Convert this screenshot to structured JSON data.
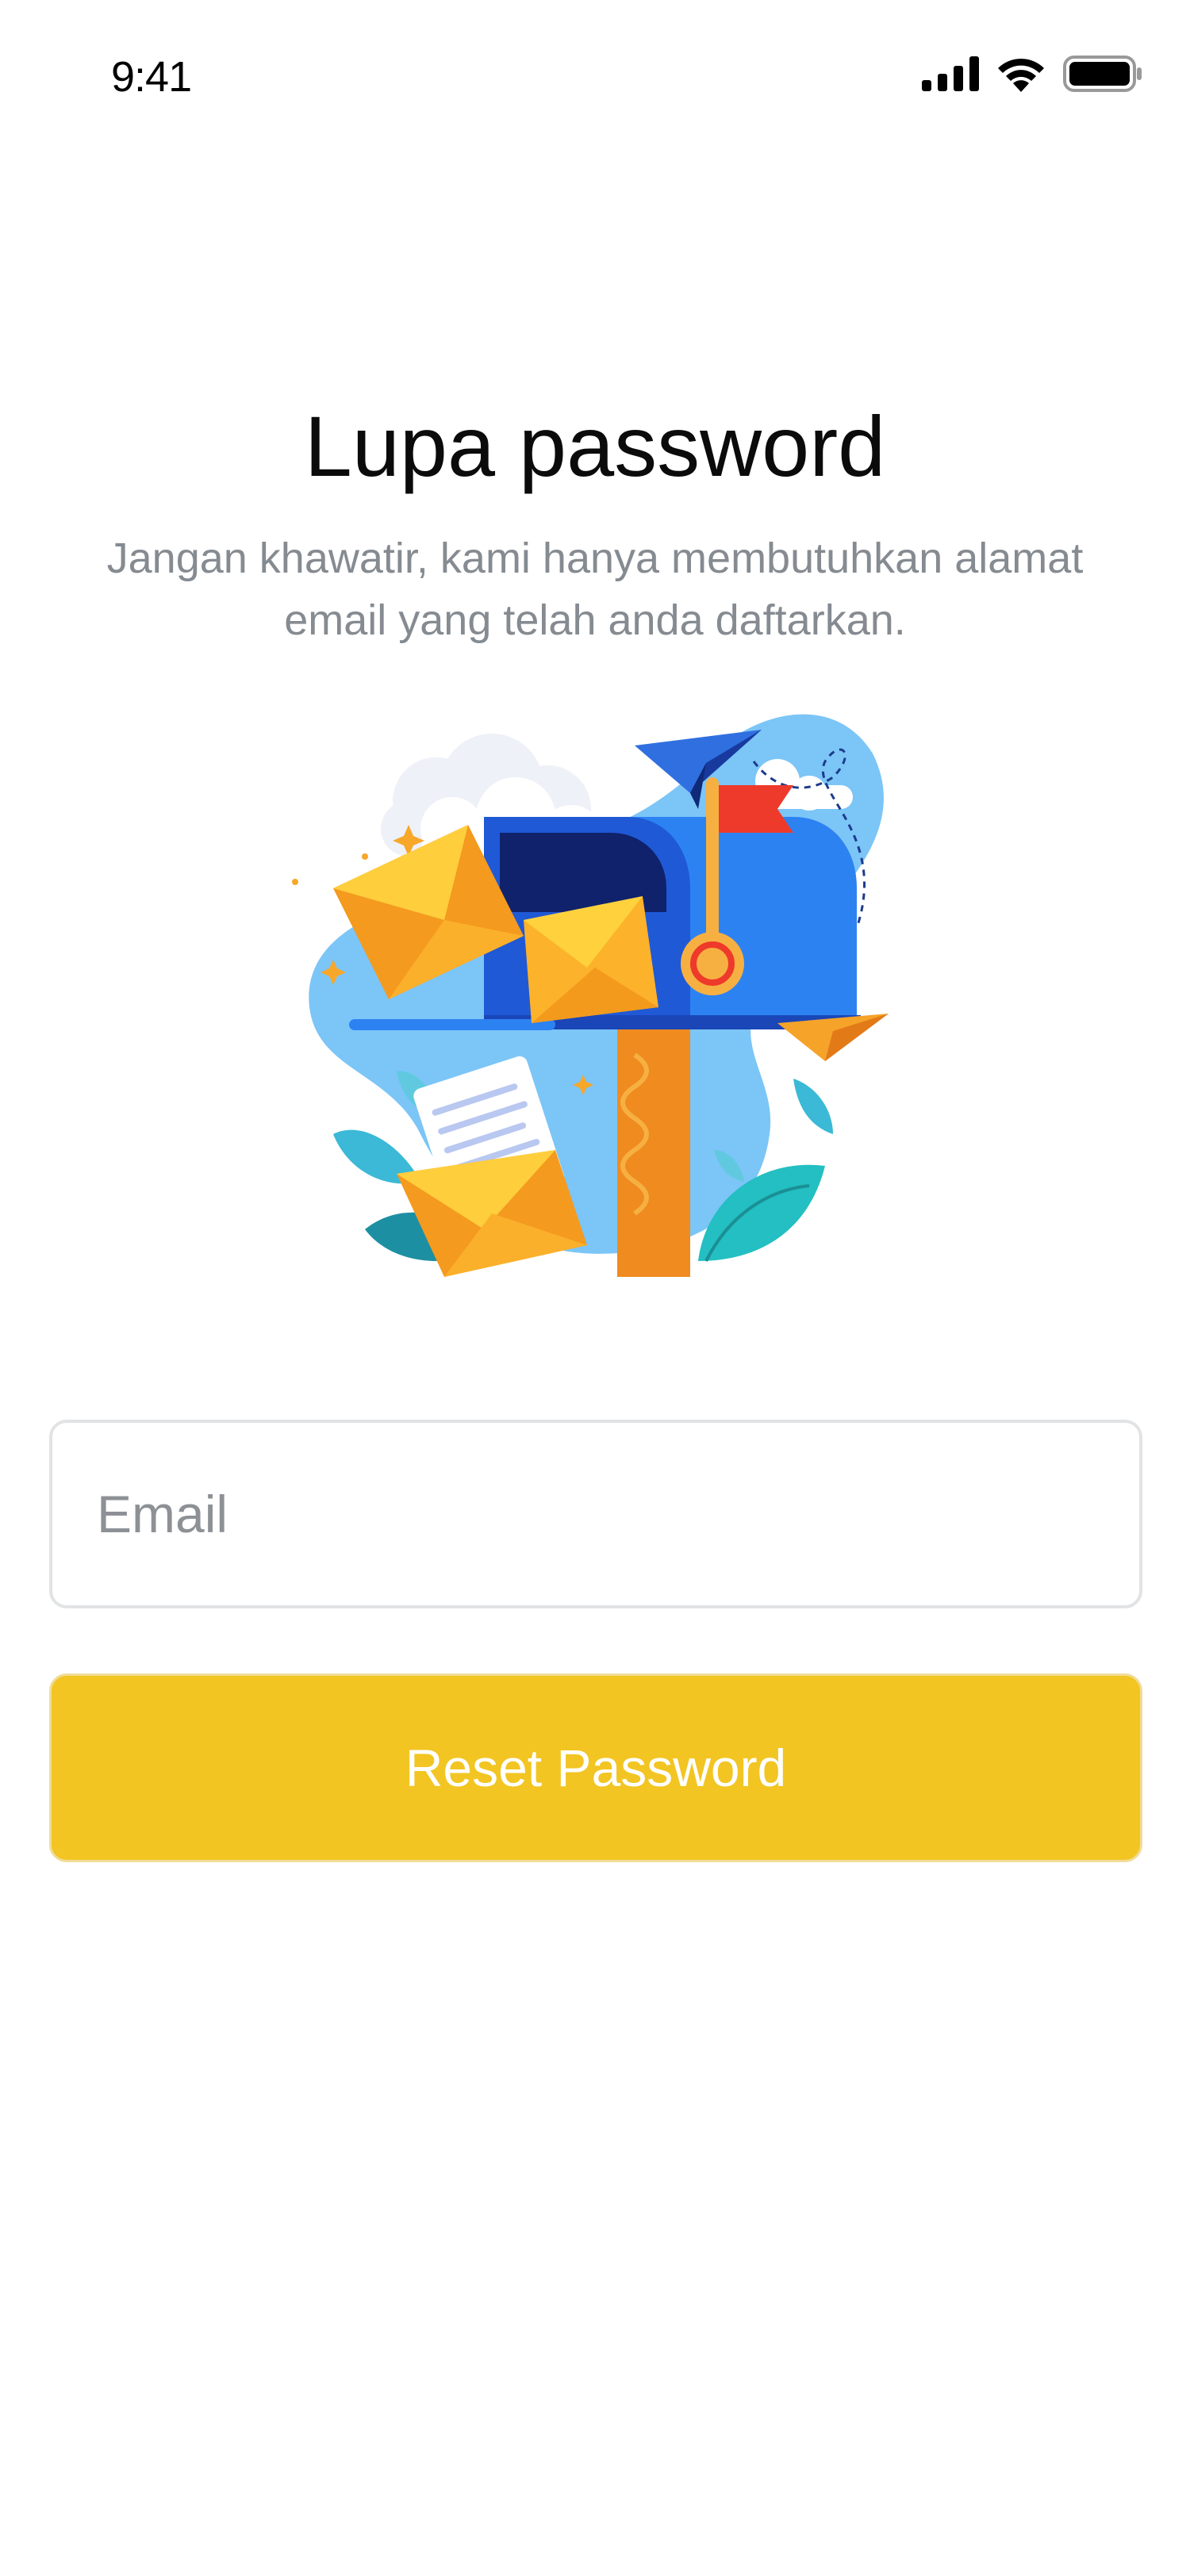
{
  "status_bar": {
    "time": "9:41",
    "icons": [
      "signal-icon",
      "wifi-icon",
      "battery-icon"
    ]
  },
  "header": {
    "title": "Lupa password",
    "subtitle_line1": "Jangan khawatir, kami hanya membutuhkan alamat",
    "subtitle_line2": "email yang telah anda daftarkan."
  },
  "illustration": {
    "name": "mailbox-illustration"
  },
  "form": {
    "email_placeholder": "Email",
    "email_value": "",
    "reset_label": "Reset Password"
  },
  "colors": {
    "accent": "#F2C523",
    "title": "#0B0B0B",
    "subtitle": "#858B91",
    "input_border": "#E1E3E5",
    "placeholder": "#8D9196"
  }
}
